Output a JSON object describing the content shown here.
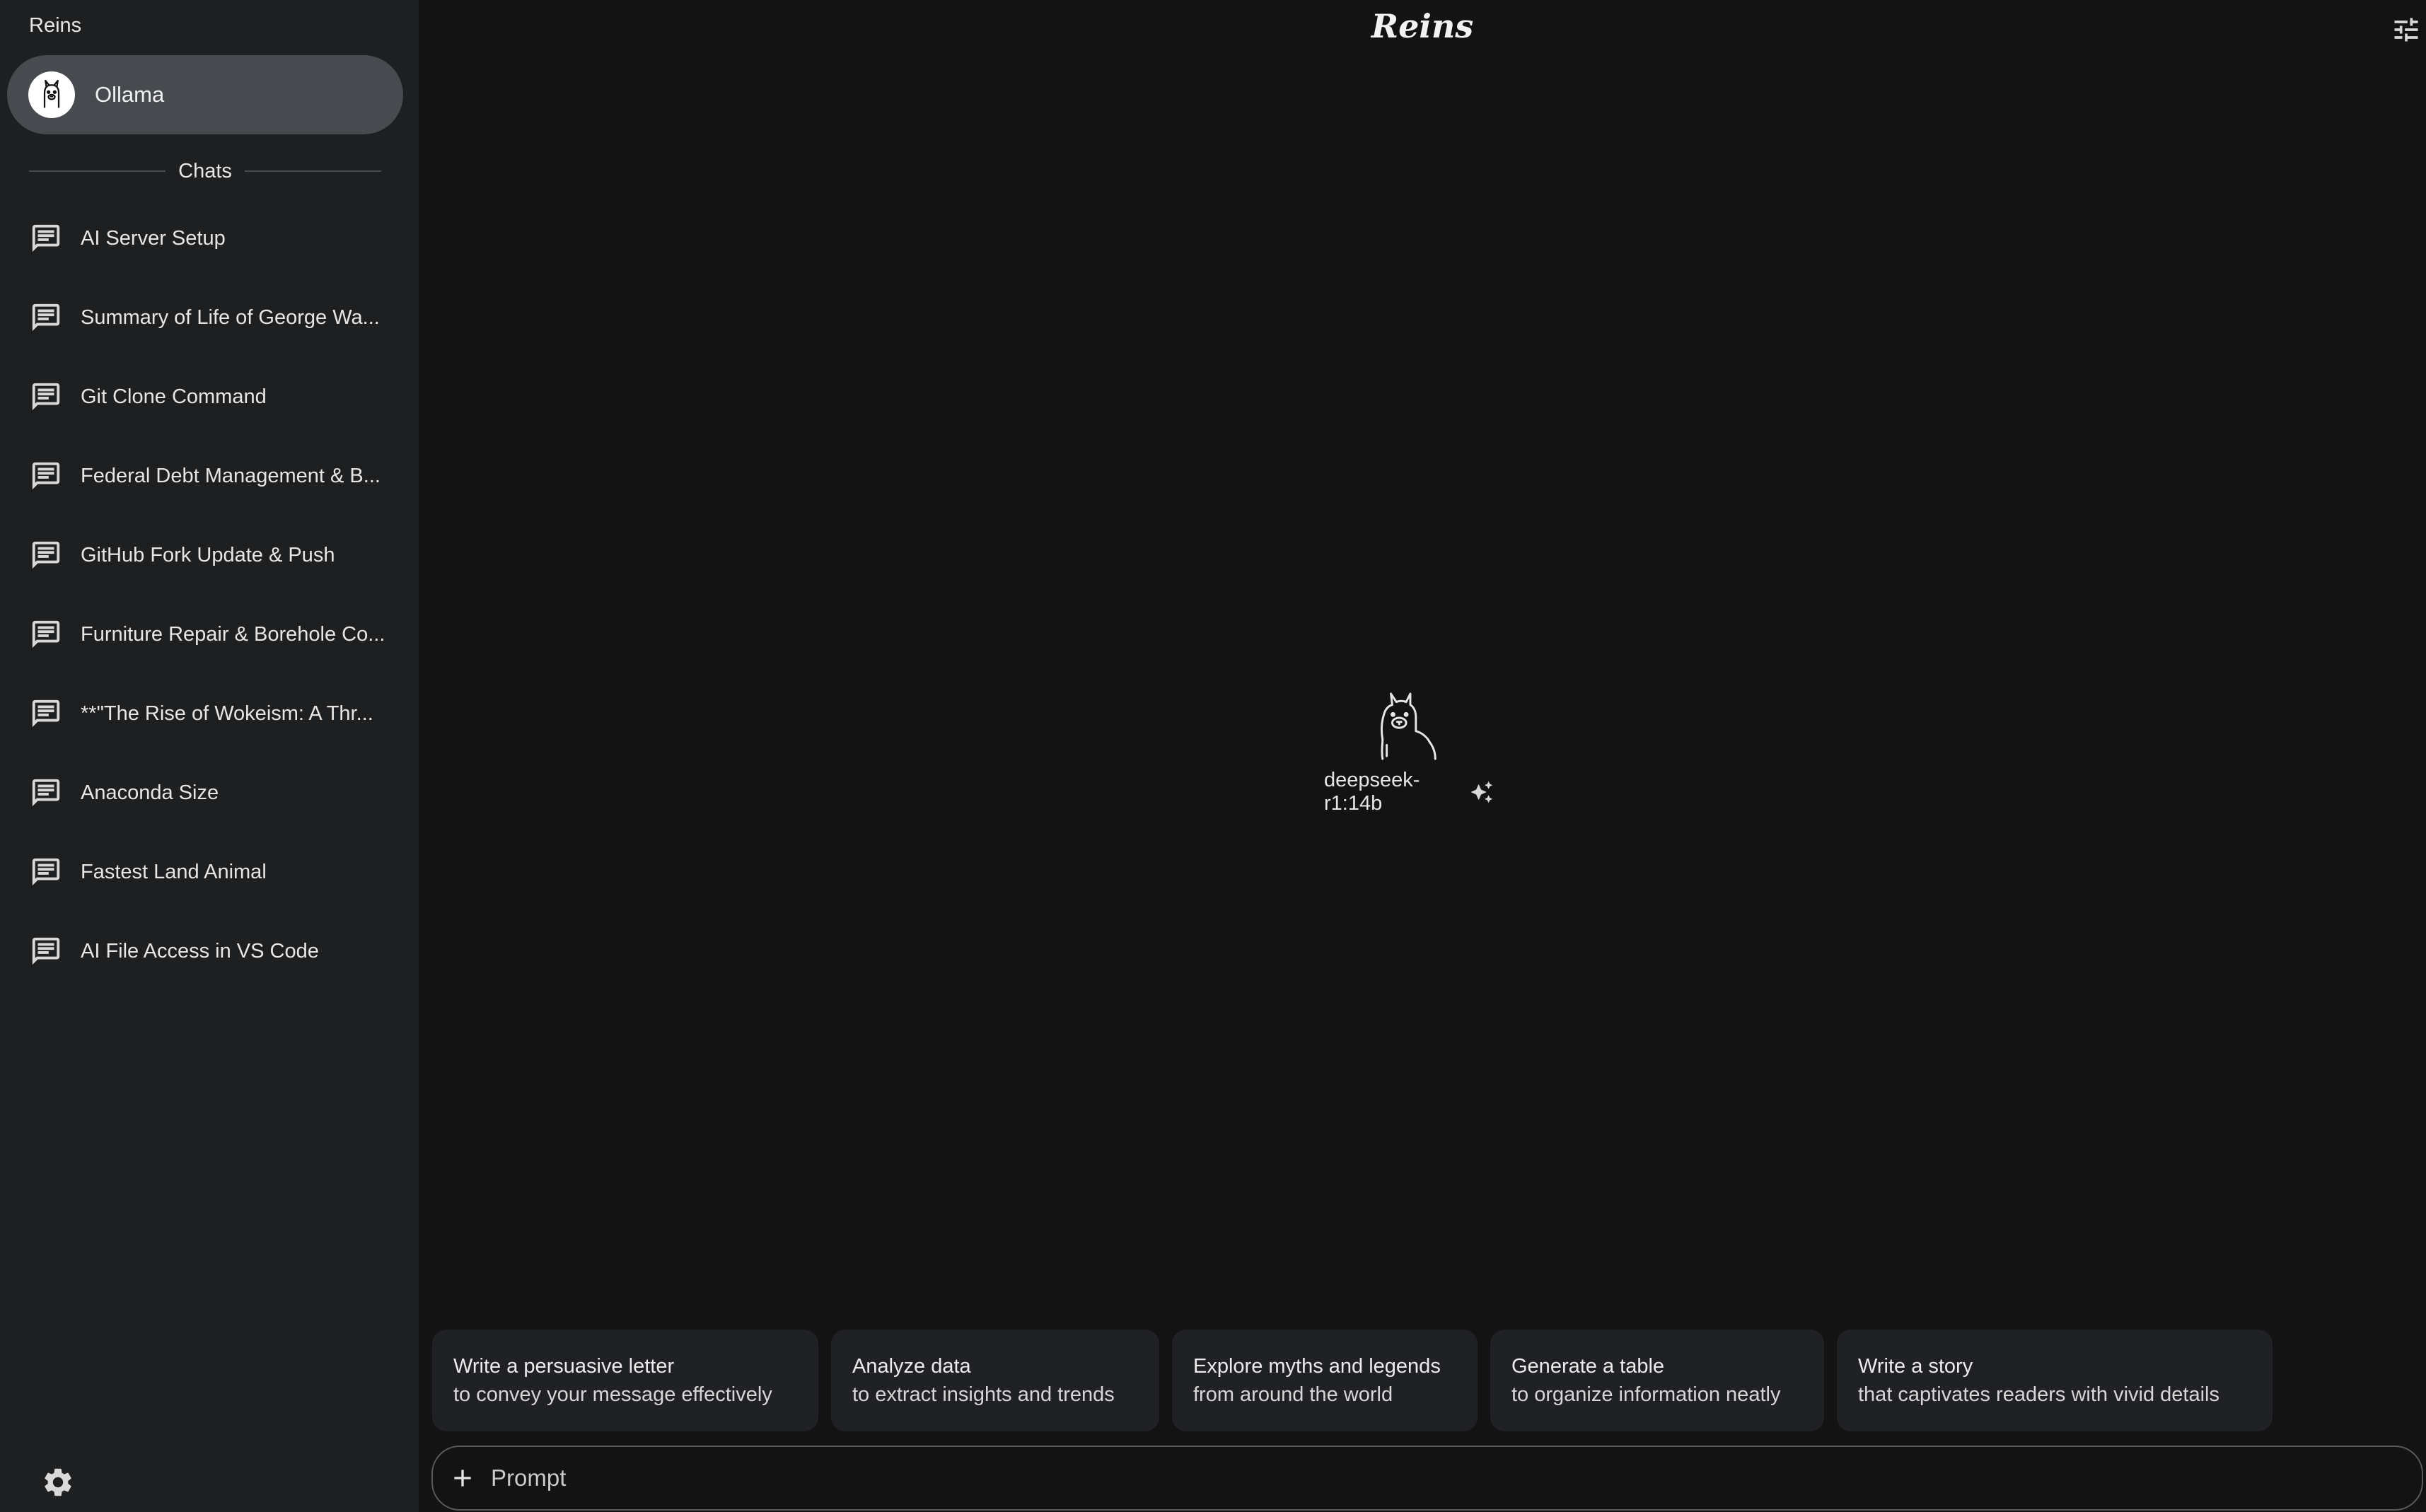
{
  "sidebar": {
    "app_name": "Reins",
    "provider": {
      "label": "Ollama",
      "icon": "llama-avatar-icon"
    },
    "section_label": "Chats",
    "chats": [
      {
        "title": "AI Server Setup"
      },
      {
        "title": "Summary of Life of George Wa..."
      },
      {
        "title": "Git Clone Command"
      },
      {
        "title": "Federal Debt Management & B..."
      },
      {
        "title": "GitHub Fork Update & Push"
      },
      {
        "title": "Furniture Repair & Borehole Co..."
      },
      {
        "title": "**\"The Rise of Wokeism: A Thr..."
      },
      {
        "title": "Anaconda Size"
      },
      {
        "title": "Fastest Land Animal"
      },
      {
        "title": "AI File Access in VS Code"
      }
    ],
    "settings_icon": "gear-icon"
  },
  "header": {
    "brand": "Reins",
    "right_icon": "tune-icon"
  },
  "center": {
    "model_name": "deepseek-r1:14b",
    "model_icon": "llama-icon",
    "model_action_icon": "sparkle-icon"
  },
  "suggestions": [
    {
      "title": "Write a persuasive letter",
      "subtitle": "to convey your message effectively"
    },
    {
      "title": "Analyze data",
      "subtitle": "to extract insights and trends"
    },
    {
      "title": "Explore myths and legends",
      "subtitle": "from around the world"
    },
    {
      "title": "Generate a table",
      "subtitle": "to organize information neatly"
    },
    {
      "title": "Write a story",
      "subtitle": "that captivates readers with vivid details"
    }
  ],
  "prompt": {
    "placeholder": "Prompt",
    "value": "",
    "add_icon": "plus-icon"
  },
  "colors": {
    "background": "#131314",
    "sidebar": "#1e1f20",
    "selected_provider": "#474a4f",
    "card": "#202124",
    "text": "#e6e6e6"
  }
}
